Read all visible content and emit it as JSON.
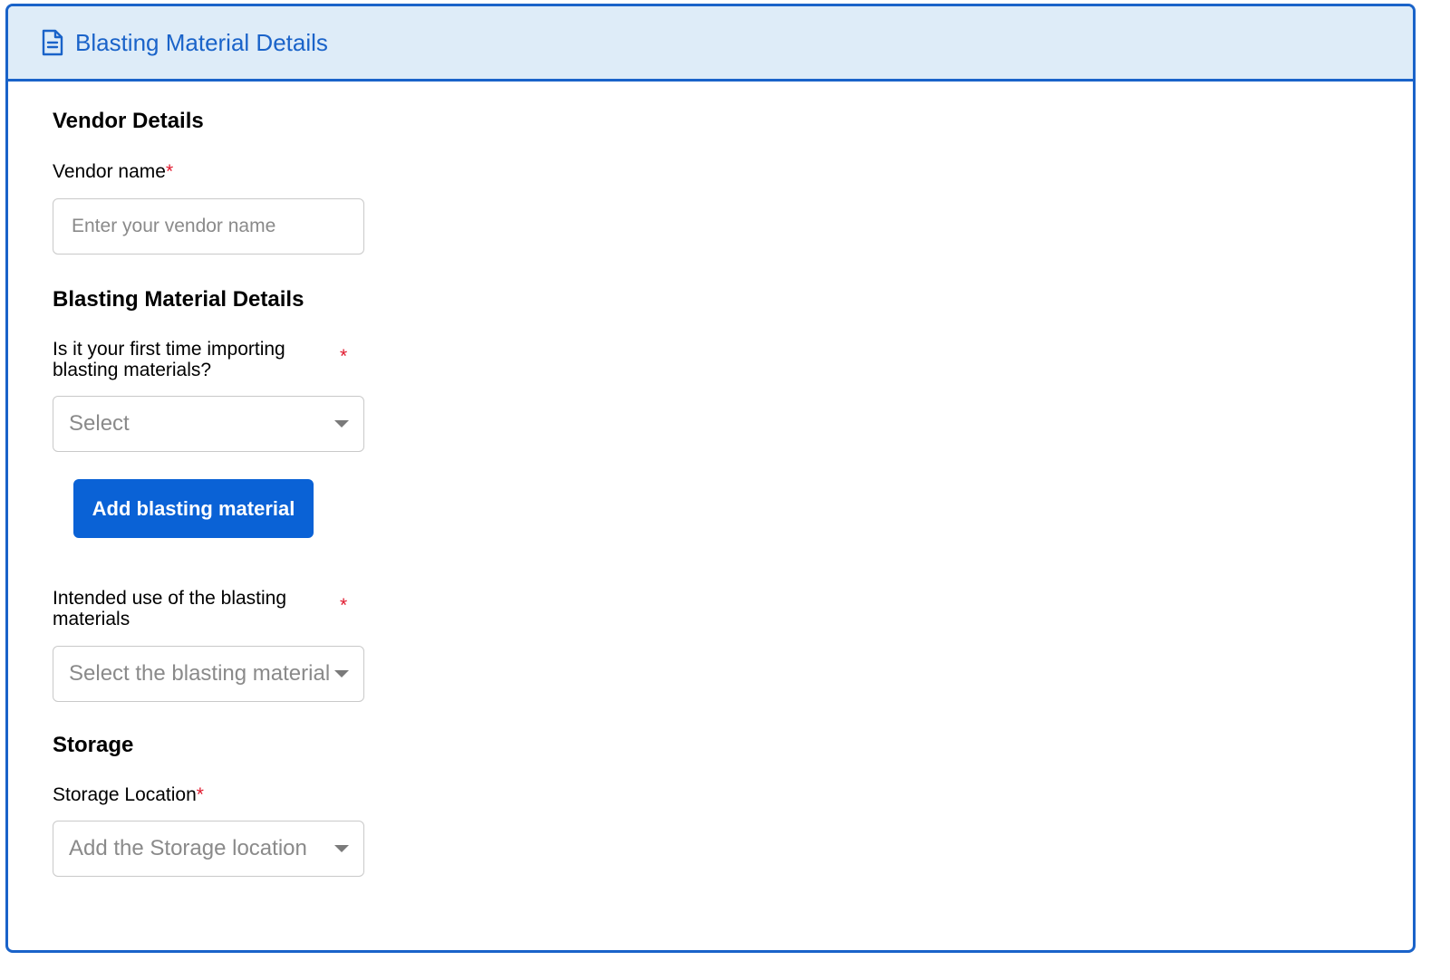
{
  "header": {
    "title": "Blasting Material Details",
    "icon": "document-icon",
    "background": "#deecf8",
    "accent": "#1a63c9"
  },
  "vendor": {
    "section_title": "Vendor Details",
    "name_label": "Vendor name",
    "required_mark": "*",
    "name_placeholder": "Enter your vendor name",
    "name_value": ""
  },
  "material": {
    "section_title": "Blasting Material Details",
    "first_time_label_line1": "Is it your first time importing",
    "first_time_label_line2": "blasting materials?",
    "required_mark": "*",
    "first_time_selected": "Select",
    "add_button_label": "Add blasting material",
    "intended_use_label_line1": "Intended use of the blasting",
    "intended_use_label_line2": "materials",
    "intended_use_selected": "Select the blasting materials"
  },
  "storage": {
    "section_title": "Storage",
    "location_label": "Storage Location",
    "required_mark": "*",
    "location_selected": "Add the Storage location"
  },
  "colors": {
    "primary_button": "#0a62d6",
    "required": "#e0182d",
    "placeholder": "#8a8a8a"
  }
}
